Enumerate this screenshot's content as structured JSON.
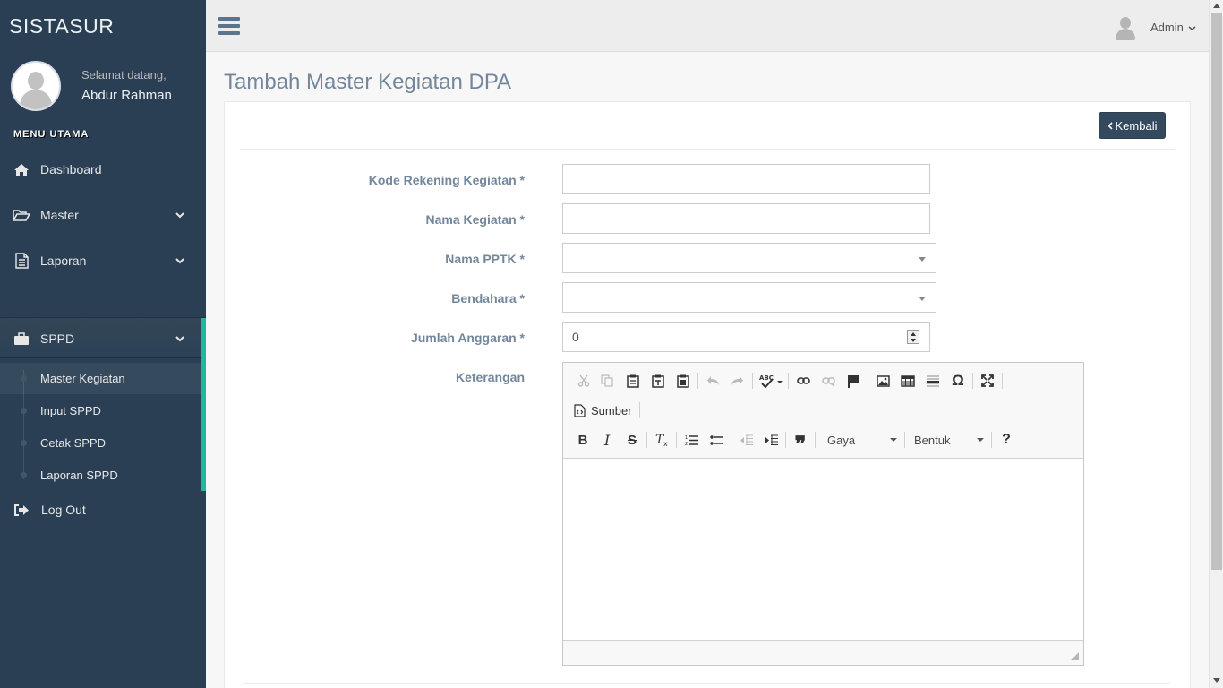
{
  "app": {
    "brand": "SISTASUR"
  },
  "sidebar": {
    "welcome": "Selamat datang,",
    "username": "Abdur Rahman",
    "menu_title": "MENU UTAMA",
    "items": [
      {
        "label": "Dashboard",
        "icon": "home-icon"
      },
      {
        "label": "Master",
        "icon": "folder-open-icon"
      },
      {
        "label": "Laporan",
        "icon": "file-text-icon"
      },
      {
        "label": "SPPD",
        "icon": "briefcase-icon"
      },
      {
        "label": "Log Out",
        "icon": "sign-out-icon"
      }
    ],
    "sppd_children": [
      {
        "label": "Master Kegiatan",
        "active": true
      },
      {
        "label": "Input SPPD"
      },
      {
        "label": "Cetak SPPD"
      },
      {
        "label": "Laporan SPPD"
      }
    ]
  },
  "topnav": {
    "user": "Admin"
  },
  "page": {
    "title": "Tambah Master Kegiatan DPA",
    "back_button": "Kembali"
  },
  "form": {
    "kode_label": "Kode Rekening Kegiatan *",
    "kode_value": "",
    "nama_label": "Nama Kegiatan *",
    "nama_value": "",
    "pptk_label": "Nama PPTK *",
    "pptk_value": "",
    "bendahara_label": "Bendahara *",
    "bendahara_value": "",
    "anggaran_label": "Jumlah Anggaran *",
    "anggaran_value": "0",
    "keterangan_label": "Keterangan"
  },
  "editor": {
    "source_label": "Sumber",
    "style_combo": "Gaya",
    "format_combo": "Bentuk",
    "help": "?"
  },
  "colors": {
    "sidebar": "#2a3f54",
    "accent": "#1abb9c",
    "button": "#34495e",
    "label": "#73879c"
  }
}
